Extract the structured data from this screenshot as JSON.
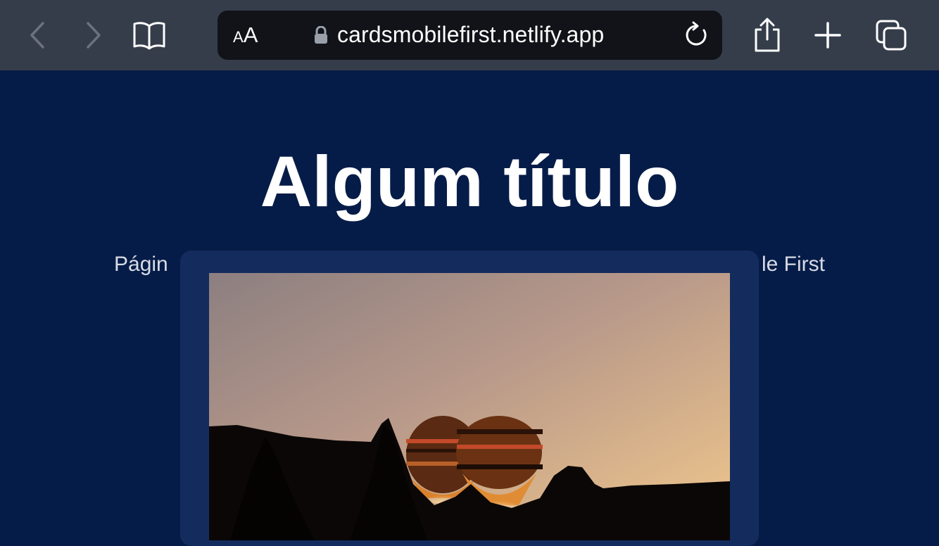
{
  "browser": {
    "reader_label_small": "A",
    "reader_label_big": "A",
    "url": "cardsmobilefirst.netlify.app",
    "icons": {
      "back": "chevron-left-icon",
      "forward": "chevron-right-icon",
      "bookmarks": "book-icon",
      "lock": "lock-icon",
      "reload": "reload-icon",
      "share": "share-icon",
      "new_tab": "plus-icon",
      "tabs": "tabs-icon"
    }
  },
  "page": {
    "title": "Algum título",
    "subtitle_start": "Págin",
    "subtitle_end": "le First",
    "card": {
      "image": "hot-air-balloons-at-sunset"
    }
  },
  "colors": {
    "toolbar_bg": "#353d4b",
    "address_bg": "#111319",
    "page_bg": "#061c48",
    "card_bg": "#142b5e"
  }
}
